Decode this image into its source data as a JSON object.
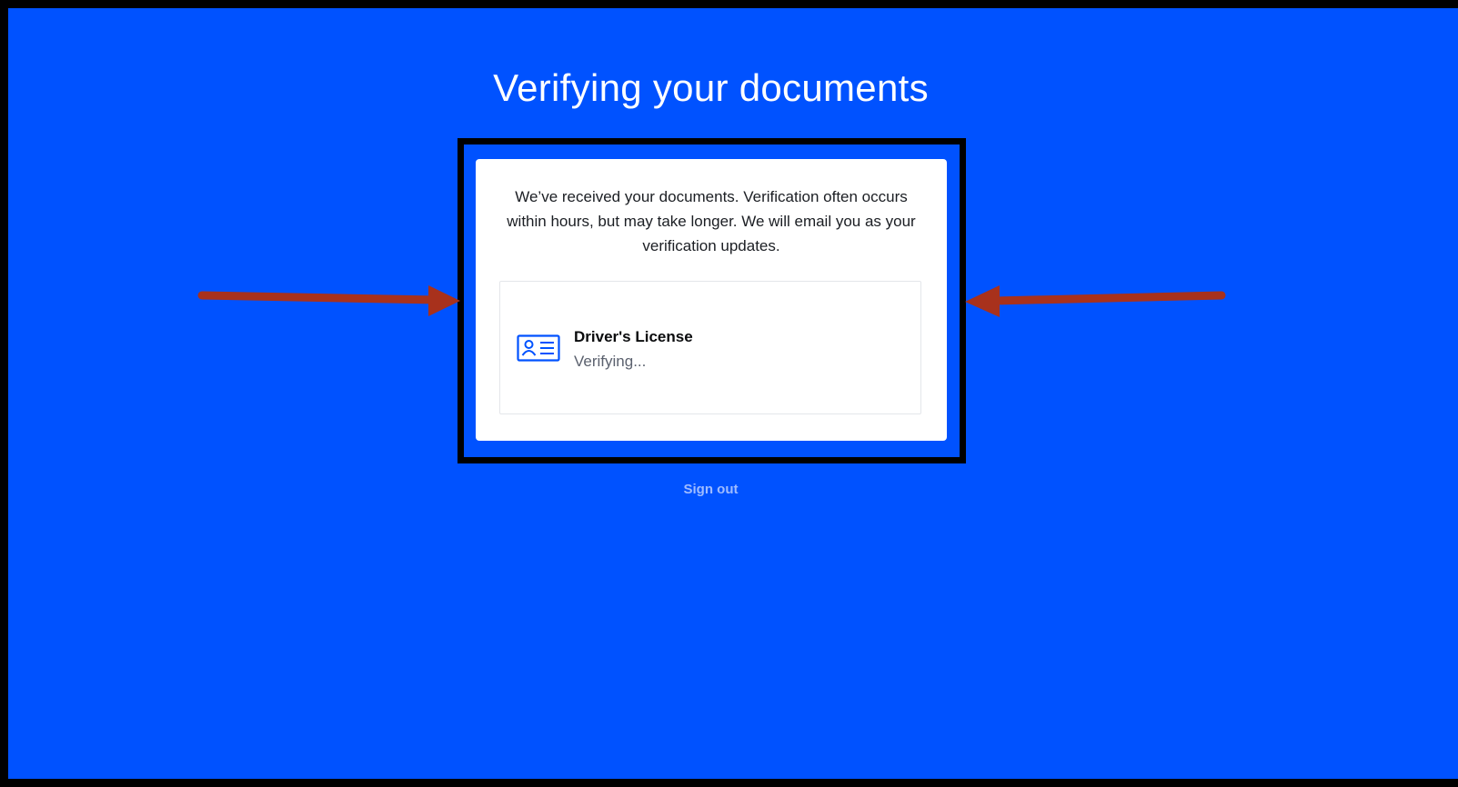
{
  "page": {
    "title": "Verifying your documents",
    "background_color": "#0052ff",
    "sign_out_label": "Sign out"
  },
  "card": {
    "message": "We’ve received your documents. Verification often occurs within hours, but may take longer. We will email you as your verification updates.",
    "document": {
      "icon": "id-card-icon",
      "name": "Driver's License",
      "status": "Verifying..."
    }
  },
  "annotations": {
    "arrow_color": "#a8311c",
    "highlight_color": "#000000"
  }
}
